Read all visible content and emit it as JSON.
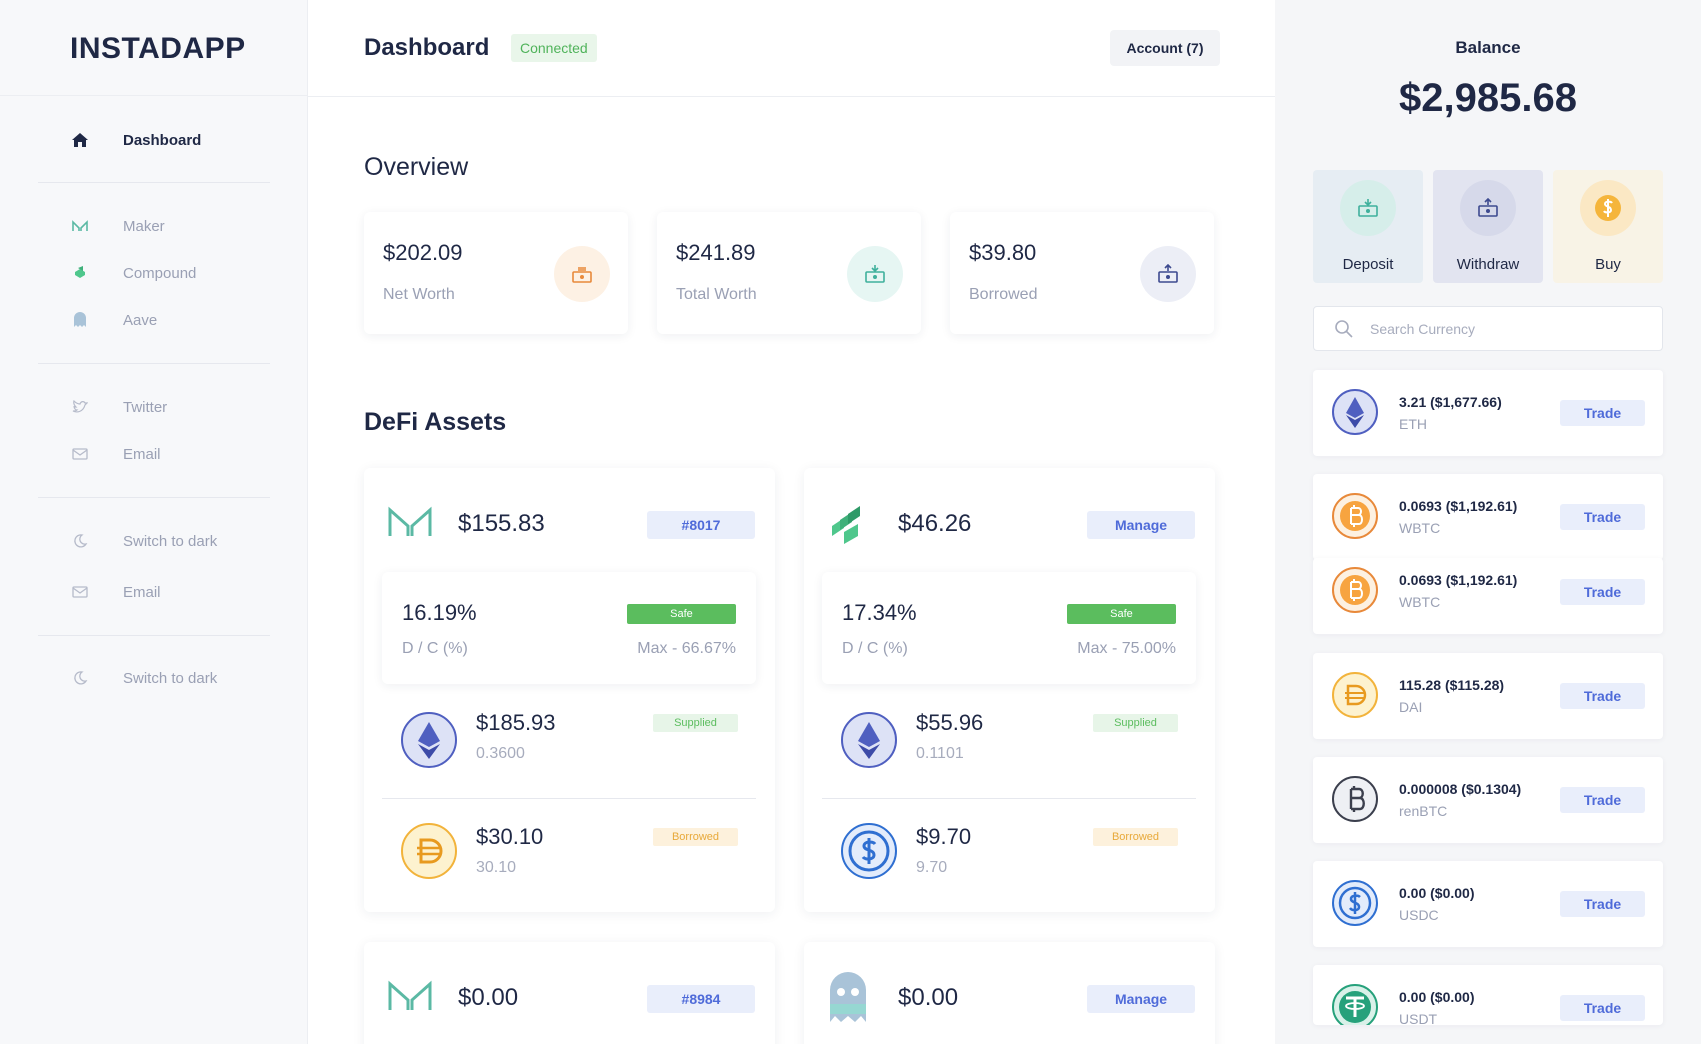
{
  "logo": "INSTADAPP",
  "sidebar": {
    "items": [
      {
        "label": "Dashboard",
        "icon": "home-icon"
      },
      {
        "label": "Maker",
        "icon": "maker-icon"
      },
      {
        "label": "Compound",
        "icon": "compound-icon"
      },
      {
        "label": "Aave",
        "icon": "aave-icon"
      },
      {
        "label": "Twitter",
        "icon": "twitter-icon"
      },
      {
        "label": "Email",
        "icon": "email-icon"
      },
      {
        "label": "Switch to dark",
        "icon": "moon-icon"
      },
      {
        "label": "Email",
        "icon": "email-icon"
      },
      {
        "label": "Switch to dark",
        "icon": "moon-icon"
      }
    ]
  },
  "header": {
    "title": "Dashboard",
    "status": "Connected",
    "account": "Account (7)"
  },
  "overview": {
    "title": "Overview",
    "cards": [
      {
        "value": "$202.09",
        "label": "Net Worth",
        "icon": "cash-icon"
      },
      {
        "value": "$241.89",
        "label": "Total Worth",
        "icon": "deposit-icon"
      },
      {
        "value": "$39.80",
        "label": "Borrowed",
        "icon": "withdraw-icon"
      }
    ]
  },
  "defi": {
    "title": "DeFi Assets",
    "cards": [
      {
        "protocol_icon": "maker-icon",
        "value": "$155.83",
        "action": "#8017",
        "ratio": "16.19%",
        "ratio_label": "D / C (%)",
        "status": "Safe",
        "max": "Max - 66.67%",
        "positions": [
          {
            "value": "$185.93",
            "amount": "0.3600",
            "badge": "Supplied",
            "icon": "eth-icon"
          },
          {
            "value": "$30.10",
            "amount": "30.10",
            "badge": "Borrowed",
            "icon": "dai-icon"
          }
        ]
      },
      {
        "protocol_icon": "compound-icon",
        "value": "$46.26",
        "action": "Manage",
        "ratio": "17.34%",
        "ratio_label": "D / C (%)",
        "status": "Safe",
        "max": "Max - 75.00%",
        "positions": [
          {
            "value": "$55.96",
            "amount": "0.1101",
            "badge": "Supplied",
            "icon": "eth-icon"
          },
          {
            "value": "$9.70",
            "amount": "9.70",
            "badge": "Borrowed",
            "icon": "usdc-icon"
          }
        ]
      },
      {
        "protocol_icon": "maker-icon",
        "value": "$0.00",
        "action": "#8984"
      },
      {
        "protocol_icon": "aave-icon",
        "value": "$0.00",
        "action": "Manage"
      }
    ]
  },
  "balance": {
    "label": "Balance",
    "value": "$2,985.68",
    "actions": [
      {
        "label": "Deposit",
        "icon": "deposit-icon"
      },
      {
        "label": "Withdraw",
        "icon": "withdraw-icon"
      },
      {
        "label": "Buy",
        "icon": "dollar-icon"
      }
    ],
    "search_placeholder": "Search Currency",
    "trade_label": "Trade",
    "currencies": [
      {
        "amount": "3.21 ($1,677.66)",
        "symbol": "ETH",
        "icon": "eth-icon"
      },
      {
        "amount": "0.0693 ($1,192.61)",
        "symbol": "WBTC",
        "icon": "wbtc-icon"
      },
      {
        "amount": "0.0693 ($1,192.61)",
        "symbol": "WBTC",
        "icon": "wbtc-icon"
      },
      {
        "amount": "115.28 ($115.28)",
        "symbol": "DAI",
        "icon": "dai-icon"
      },
      {
        "amount": "0.000008 ($0.1304)",
        "symbol": "renBTC",
        "icon": "renbtc-icon"
      },
      {
        "amount": "0.00 ($0.00)",
        "symbol": "USDC",
        "icon": "usdc-icon"
      },
      {
        "amount": "0.00 ($0.00)",
        "symbol": "USDT",
        "icon": "usdt-icon"
      }
    ]
  },
  "colors": {
    "accent_blue": "#4f6bd9",
    "safe_green": "#5bbd5e",
    "borrowed_orange": "#e8a93a",
    "text_dark": "#1f2845",
    "text_muted": "#9aa0b4"
  }
}
